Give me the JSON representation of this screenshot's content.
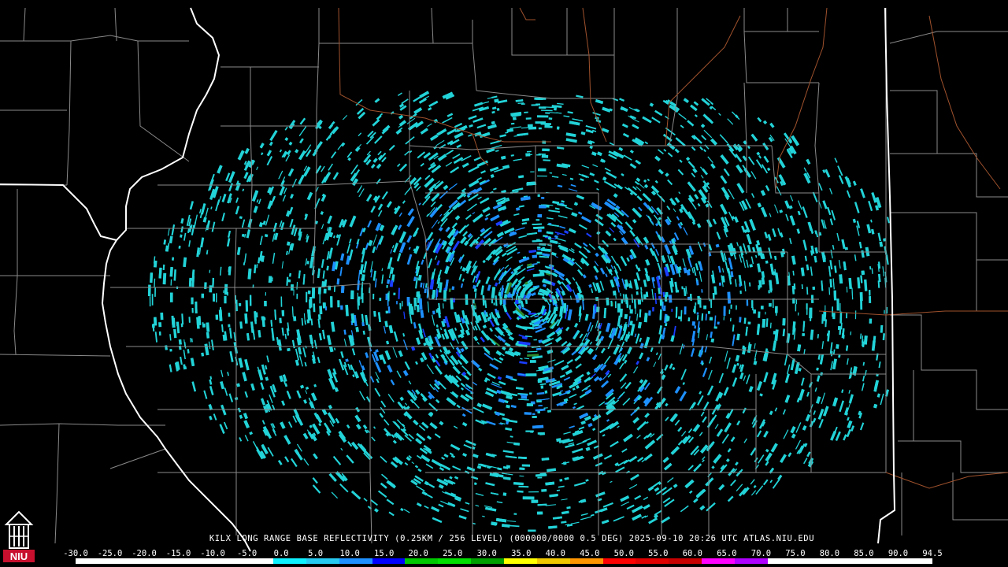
{
  "map": {
    "title": "KILX LONG RANGE BASE REFLECTIVITY (0.25KM / 256 LEVEL) (000000/0000 0.5 DEG) 2025-09-10 20:26 UTC  ATLAS.NIU.EDU",
    "logo_text": "NIU",
    "colors": {
      "background": "#000000",
      "county_lines": "#8a8a8a",
      "state_lines": "#ffffff",
      "highways": "#a0522d",
      "echo_light": "#22d3d8",
      "echo_mid": "#1e90ff",
      "echo_strong": "#1a3dff",
      "echo_green": "#2e8b2e",
      "logo_red": "#c8102e"
    },
    "legend": {
      "labels": [
        "-30.0",
        "-25.0",
        "-20.0",
        "-15.0",
        "-10.0",
        "-5.0",
        "0.0",
        "5.0",
        "10.0",
        "15.0",
        "20.0",
        "25.0",
        "30.0",
        "35.0",
        "40.0",
        "45.0",
        "50.0",
        "55.0",
        "60.0",
        "65.0",
        "70.0",
        "75.0",
        "80.0",
        "85.0",
        "90.0",
        "94.5"
      ],
      "colors": [
        "#ffffff",
        "#ffffff",
        "#ffffff",
        "#ffffff",
        "#ffffff",
        "#ffffff",
        "#0ff0ff",
        "#27c9f0",
        "#1e90ff",
        "#0000ff",
        "#00c800",
        "#00e000",
        "#00a000",
        "#ffff00",
        "#f0c800",
        "#ff9600",
        "#ff0000",
        "#e00000",
        "#c80000",
        "#ff00ff",
        "#b000ff",
        "#ffffff",
        "#ffffff",
        "#ffffff",
        "#ffffff",
        "#ffffff"
      ]
    }
  }
}
